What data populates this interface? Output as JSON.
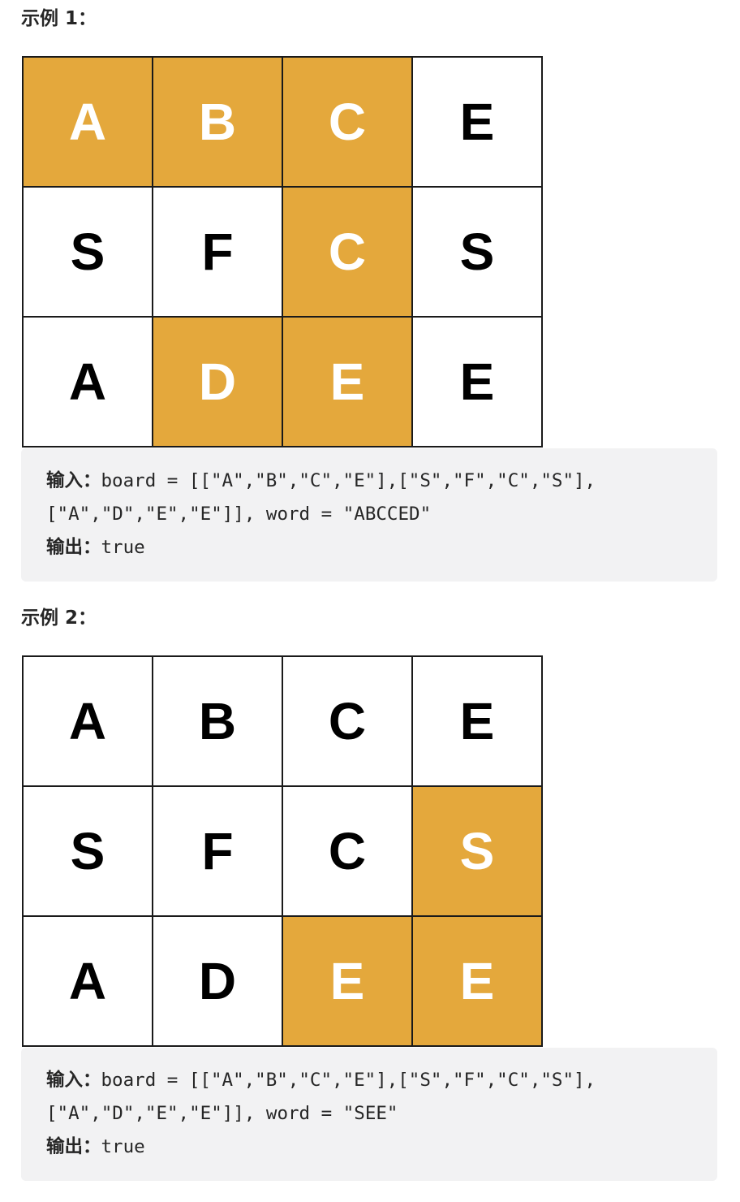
{
  "examples": [
    {
      "title": "示例 1：",
      "board": [
        [
          "A",
          "B",
          "C",
          "E"
        ],
        [
          "S",
          "F",
          "C",
          "S"
        ],
        [
          "A",
          "D",
          "E",
          "E"
        ]
      ],
      "highlighted": [
        [
          true,
          true,
          true,
          false
        ],
        [
          false,
          false,
          true,
          false
        ],
        [
          false,
          true,
          true,
          false
        ]
      ],
      "input_label": "输入：",
      "input_line1": "board = [[\"A\",\"B\",\"C\",\"E\"],[\"S\",\"F\",\"C\",\"S\"],",
      "input_line2": "[\"A\",\"D\",\"E\",\"E\"]], word = \"ABCCED\"",
      "output_label": "输出：",
      "output_value": "true"
    },
    {
      "title": "示例 2：",
      "board": [
        [
          "A",
          "B",
          "C",
          "E"
        ],
        [
          "S",
          "F",
          "C",
          "S"
        ],
        [
          "A",
          "D",
          "E",
          "E"
        ]
      ],
      "highlighted": [
        [
          false,
          false,
          false,
          false
        ],
        [
          false,
          false,
          false,
          true
        ],
        [
          false,
          false,
          true,
          true
        ]
      ],
      "input_label": "输入：",
      "input_line1": "board = [[\"A\",\"B\",\"C\",\"E\"],[\"S\",\"F\",\"C\",\"S\"],",
      "input_line2": "[\"A\",\"D\",\"E\",\"E\"]], word = \"SEE\"",
      "output_label": "输出：",
      "output_value": "true"
    }
  ],
  "colors": {
    "highlight": "#e4a83c",
    "cell_border": "#1a1a1a",
    "code_background": "#f2f2f3"
  }
}
